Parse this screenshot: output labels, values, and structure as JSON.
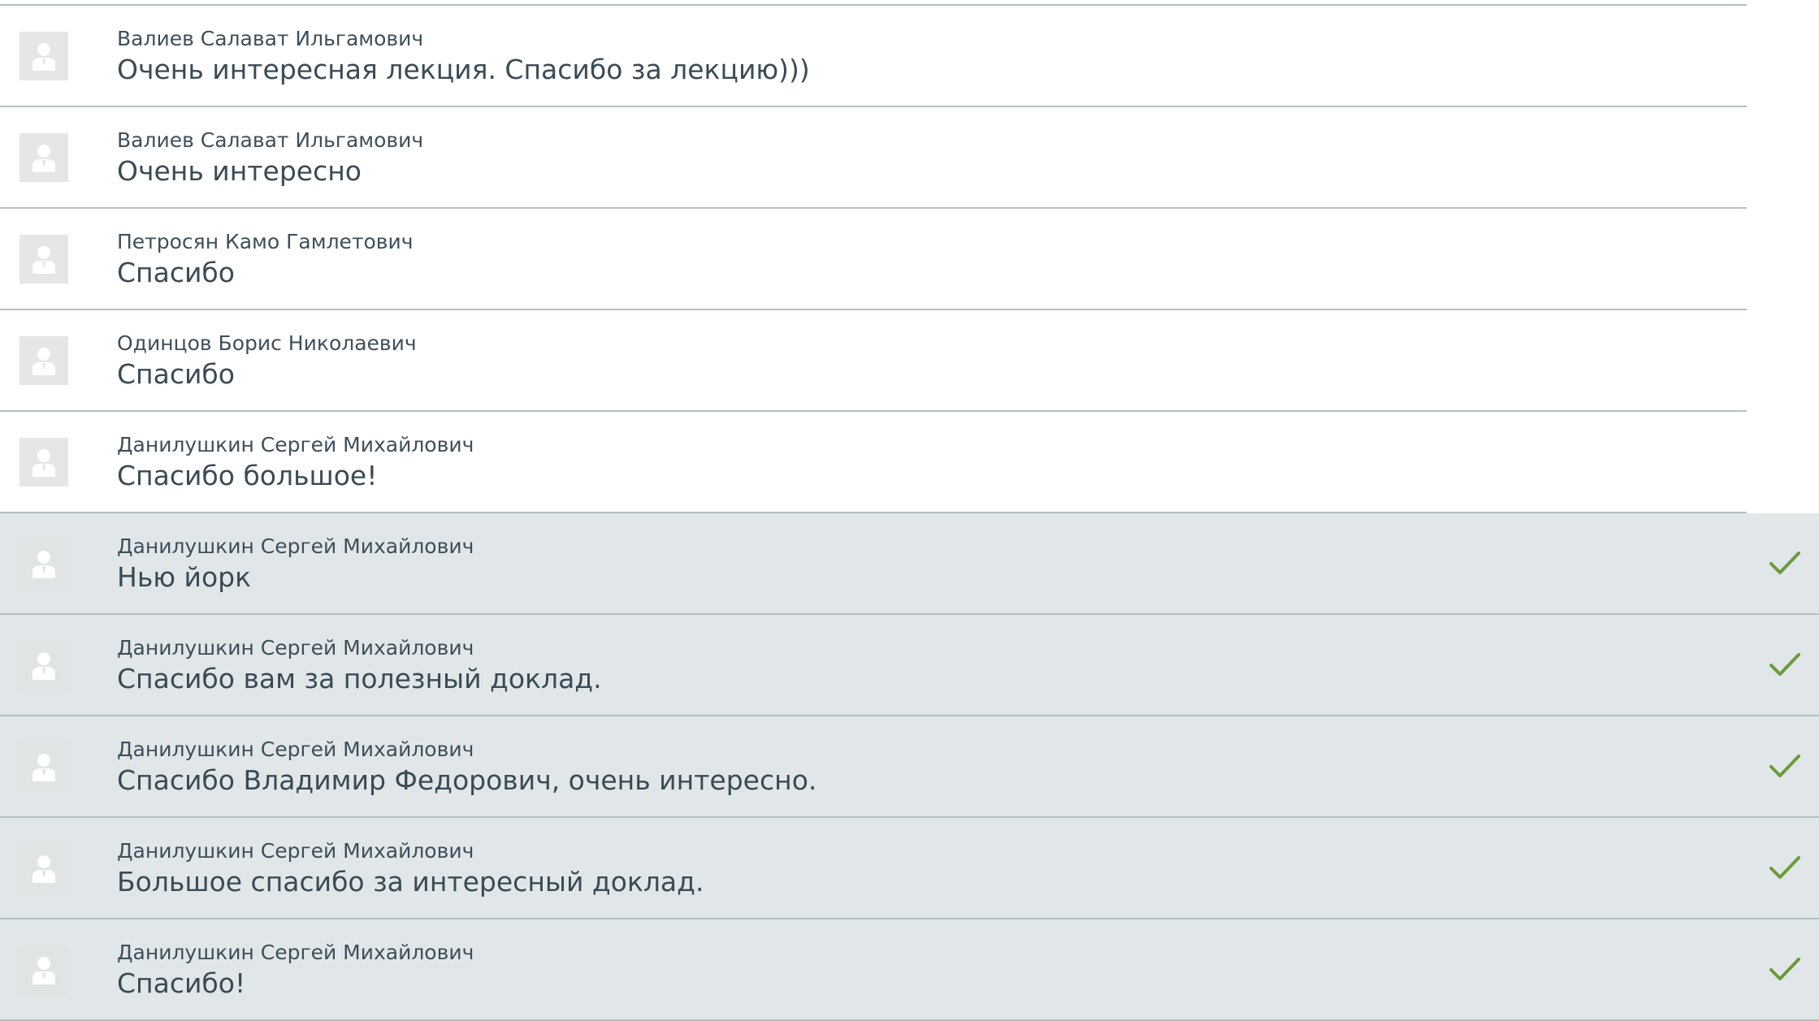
{
  "colors": {
    "divider": "#b4c0c6",
    "read_background": "#e1e7e8",
    "check": "#6b9a3a",
    "text": "#3d4f5c"
  },
  "comments": [
    {
      "author": "Валиев Салават Ильгамович",
      "text": "Очень интересная лекция. Спасибо за лекцию)))",
      "approved": false
    },
    {
      "author": "Валиев Салават Ильгамович",
      "text": "Очень интересно",
      "approved": false
    },
    {
      "author": "Петросян Камо Гамлетович",
      "text": "Спасибо",
      "approved": false
    },
    {
      "author": "Одинцов Борис Николаевич",
      "text": "Спасибо",
      "approved": false
    },
    {
      "author": "Данилушкин Сергей Михайлович",
      "text": "Спасибо большое!",
      "approved": false
    },
    {
      "author": "Данилушкин Сергей Михайлович",
      "text": "Нью йорк",
      "approved": true
    },
    {
      "author": "Данилушкин Сергей Михайлович",
      "text": "Спасибо вам за полезный доклад.",
      "approved": true
    },
    {
      "author": "Данилушкин Сергей Михайлович",
      "text": "Спасибо Владимир Федорович, очень интересно.",
      "approved": true
    },
    {
      "author": "Данилушкин Сергей Михайлович",
      "text": "Большое спасибо за интересный доклад.",
      "approved": true
    },
    {
      "author": "Данилушкин Сергей Михайлович",
      "text": "Спасибо!",
      "approved": true
    }
  ],
  "icons": {
    "avatar": "user-avatar-icon",
    "approved": "checkmark-icon"
  }
}
